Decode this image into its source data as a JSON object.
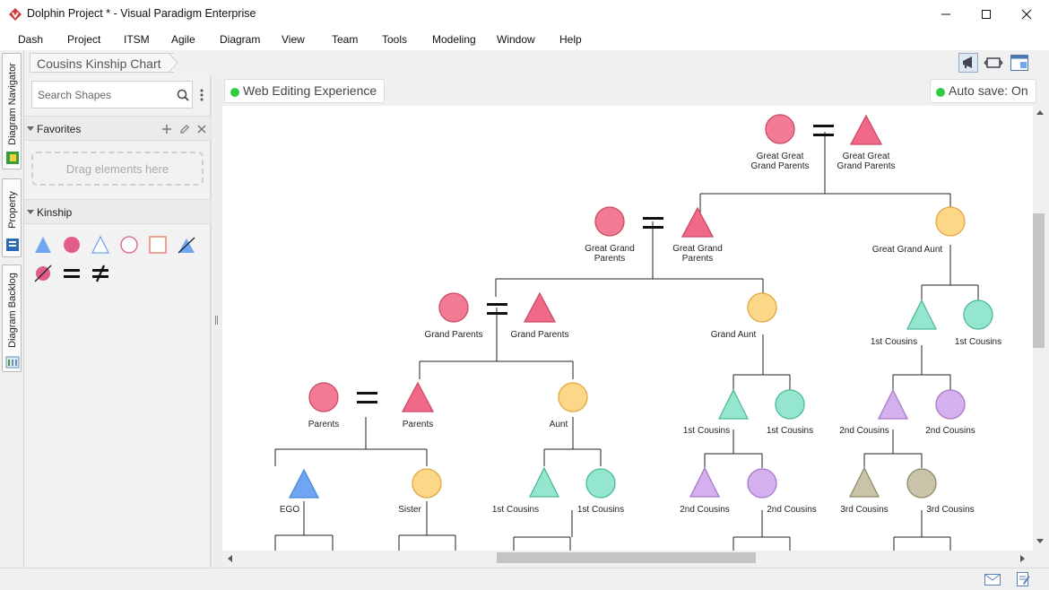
{
  "window": {
    "title": "Dolphin Project * - Visual Paradigm Enterprise",
    "minimize_icon": "minimize-icon",
    "maximize_icon": "maximize-icon",
    "close_icon": "close-icon"
  },
  "menu": [
    "Dash",
    "Project",
    "ITSM",
    "Agile",
    "Diagram",
    "View",
    "Team",
    "Tools",
    "Modeling",
    "Window",
    "Help"
  ],
  "side_tabs": [
    "Diagram Navigator",
    "Property",
    "Diagram Backlog"
  ],
  "breadcrumb": "Cousins Kinship Chart",
  "toolbar_icons": [
    "megaphone-icon",
    "fit-diagram-icon",
    "panel-layout-icon"
  ],
  "shape_panel": {
    "search_placeholder": "Search Shapes",
    "favorites": {
      "title": "Favorites",
      "drop_hint": "Drag elements here"
    },
    "kinship": {
      "title": "Kinship",
      "shapes": [
        "male-triangle",
        "female-circle",
        "outline-triangle",
        "outline-circle",
        "outline-square",
        "deceased-male",
        "deceased-female",
        "marriage-symbol",
        "divorce-symbol"
      ]
    }
  },
  "canvas": {
    "web_editing": "Web Editing Experience",
    "auto_save": "Auto save: On"
  },
  "colors": {
    "pink": "#f27a92",
    "orange": "#fdd788",
    "blue": "#6ea6f3",
    "teal": "#95e6cf",
    "purple": "#d5b0ee",
    "olive": "#c9c4a9",
    "green_dot": "#2ecc40"
  },
  "diagram": {
    "labels": {
      "n1": "Great Great Grand Parents",
      "n2": "Great Great Grand Parents",
      "n3": "Great Grand Parents",
      "n4": "Great Grand Parents",
      "n5": "Great Grand Aunt",
      "n6": "Grand Parents",
      "n7": "Grand Parents",
      "n8": "Grand Aunt",
      "n9": "1st Cousins",
      "n10": "1st Cousins",
      "n11": "Parents",
      "n12": "Parents",
      "n13": "Aunt",
      "n14": "1st Cousins",
      "n15": "1st Cousins",
      "n16": "2nd Cousins",
      "n17": "2nd Cousins",
      "n18": "EGO",
      "n19": "Sister",
      "n20": "1st Cousins",
      "n21": "1st Cousins",
      "n22": "2nd Cousins",
      "n23": "2nd Cousins",
      "n24": "3rd Cousins",
      "n25": "3rd Cousins"
    }
  },
  "status_icons": [
    "mail-icon",
    "notes-icon"
  ]
}
